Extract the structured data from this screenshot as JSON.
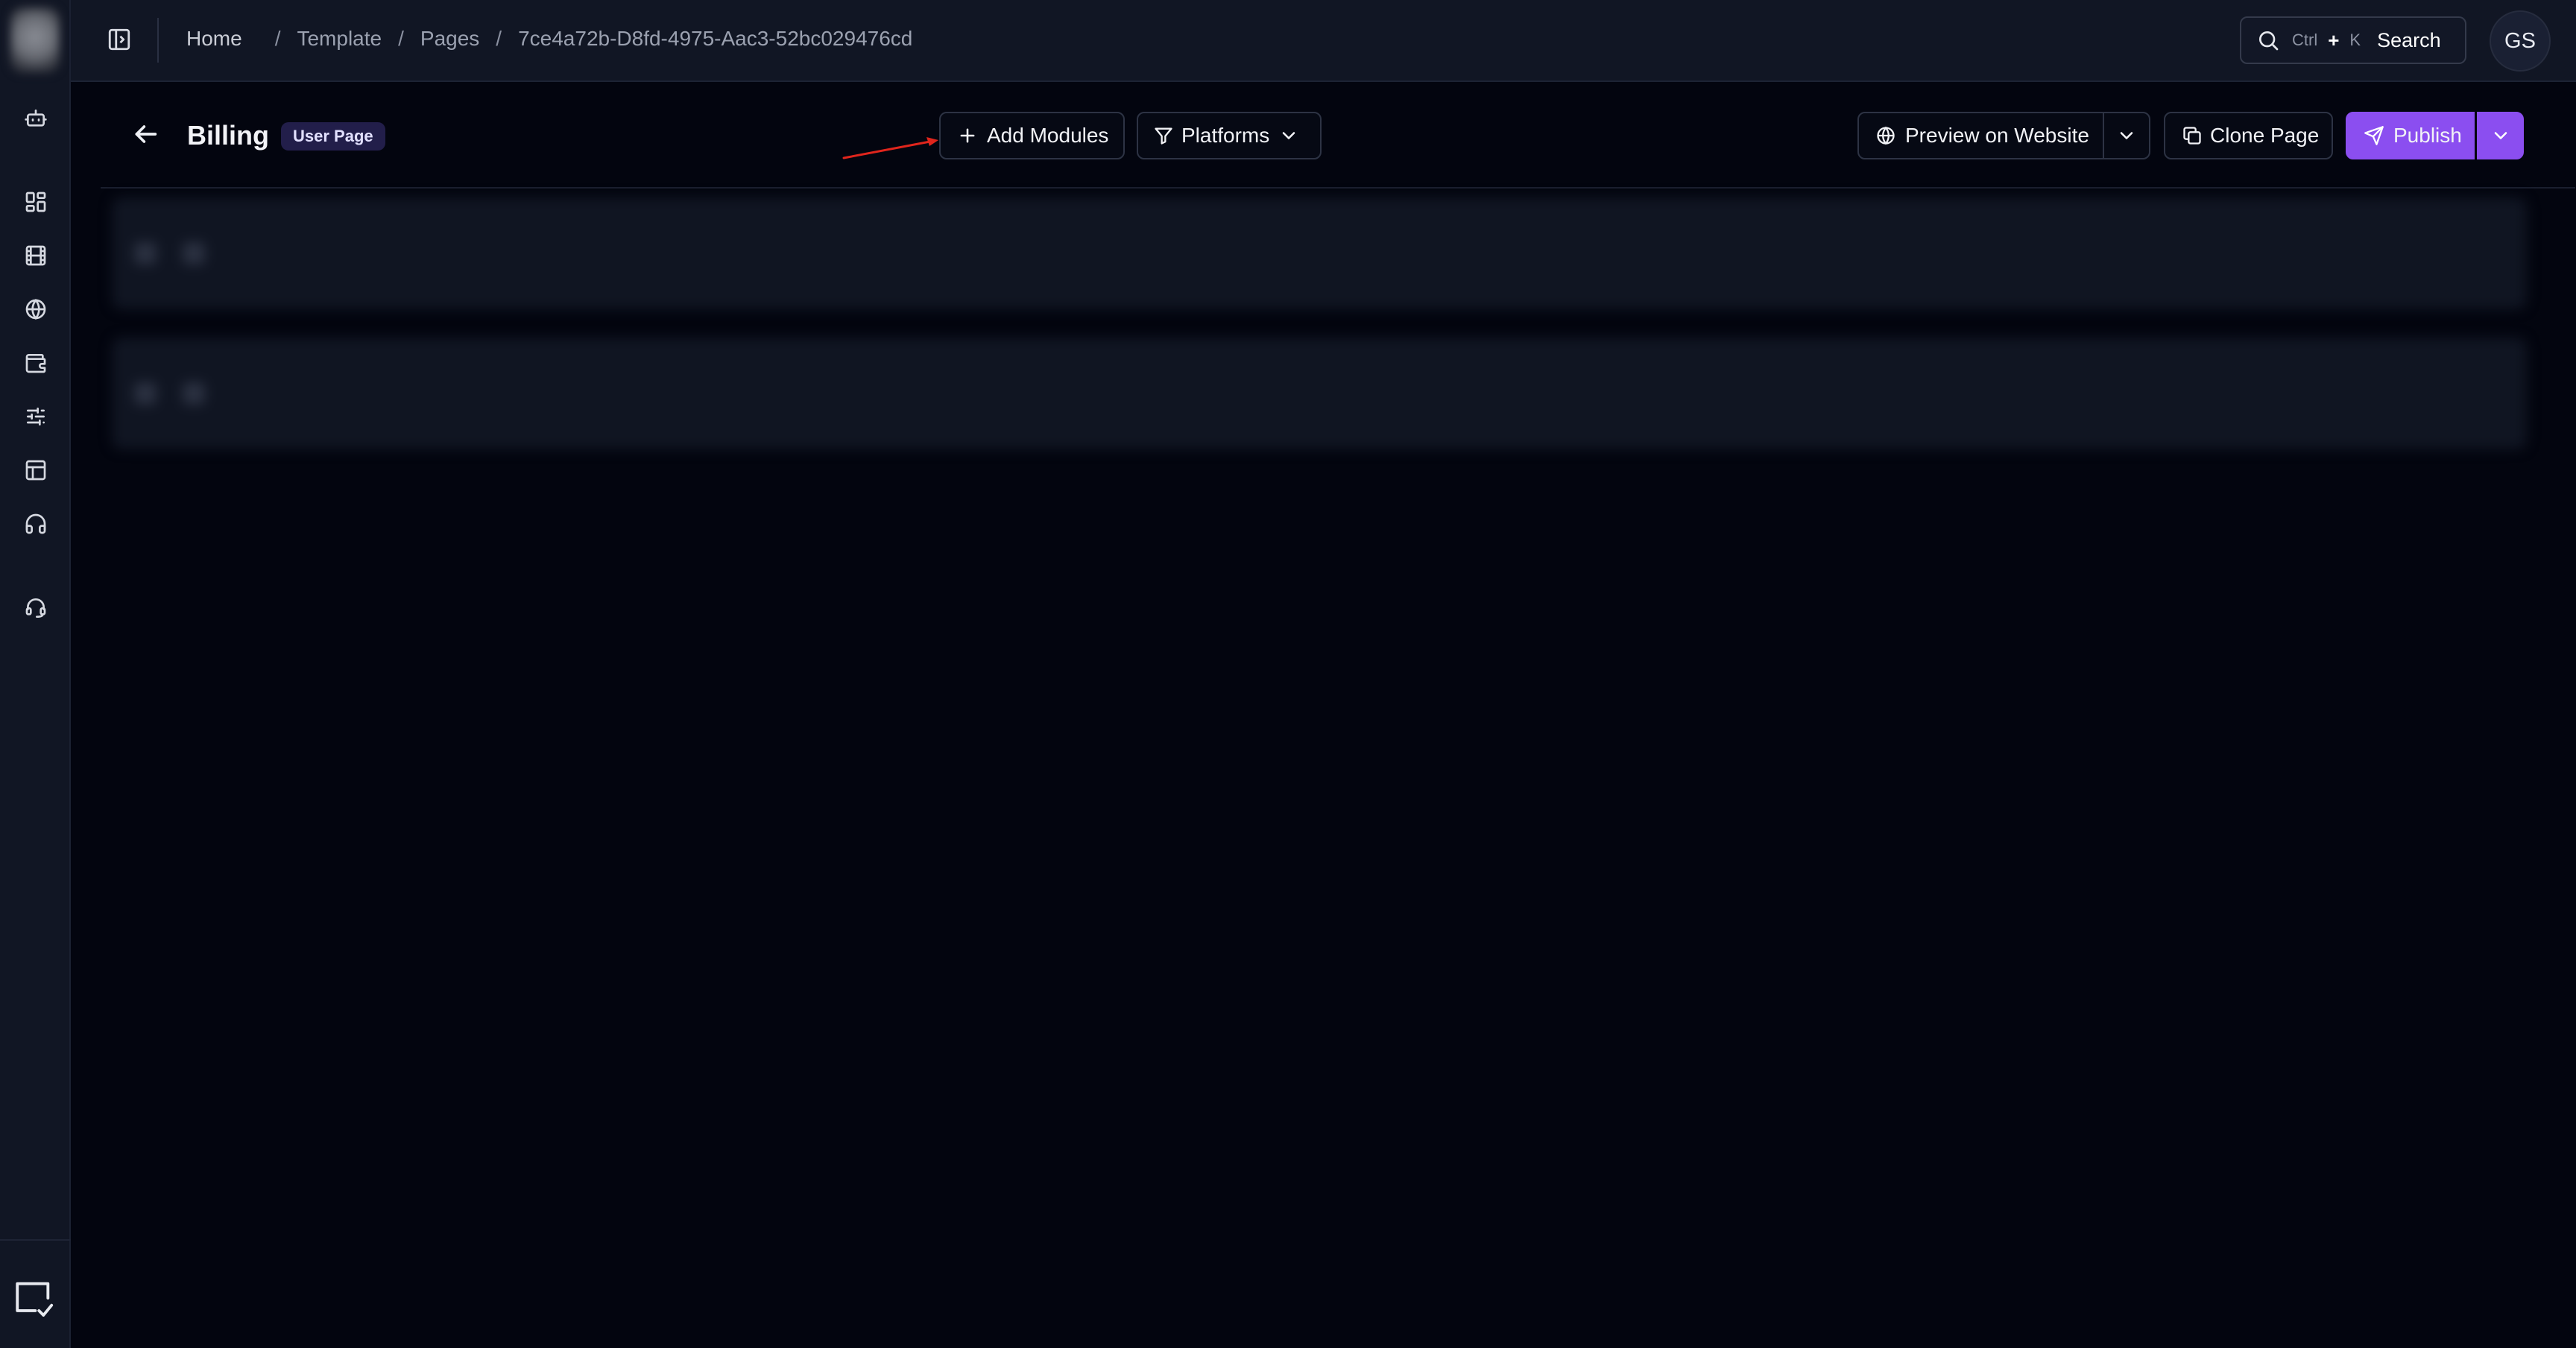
{
  "breadcrumb": {
    "home": "Home",
    "items": [
      "Template",
      "Pages",
      "7ce4a72b-D8fd-4975-Aac3-52bc029476cd"
    ]
  },
  "search": {
    "key1": "Ctrl",
    "plus": "+",
    "key2": "K",
    "label": "Search"
  },
  "user": {
    "initials": "GS"
  },
  "page": {
    "title": "Billing",
    "badge": "User Page"
  },
  "toolbar": {
    "add_modules": "Add Modules",
    "platforms": "Platforms",
    "preview": "Preview on Website",
    "clone": "Clone Page",
    "publish": "Publish"
  },
  "sidebar": {
    "icons": [
      "bot-icon",
      "dashboard-icon",
      "film-icon",
      "globe-icon",
      "wallet-icon",
      "sliders-icon",
      "layout-icon",
      "headphones-icon",
      "headset-icon"
    ],
    "bottom_icon": "monitor-check-icon"
  },
  "colors": {
    "accent": "#8b4ef0",
    "background": "#03050f",
    "surface": "#111624",
    "annotation_arrow": "#e0251c"
  }
}
